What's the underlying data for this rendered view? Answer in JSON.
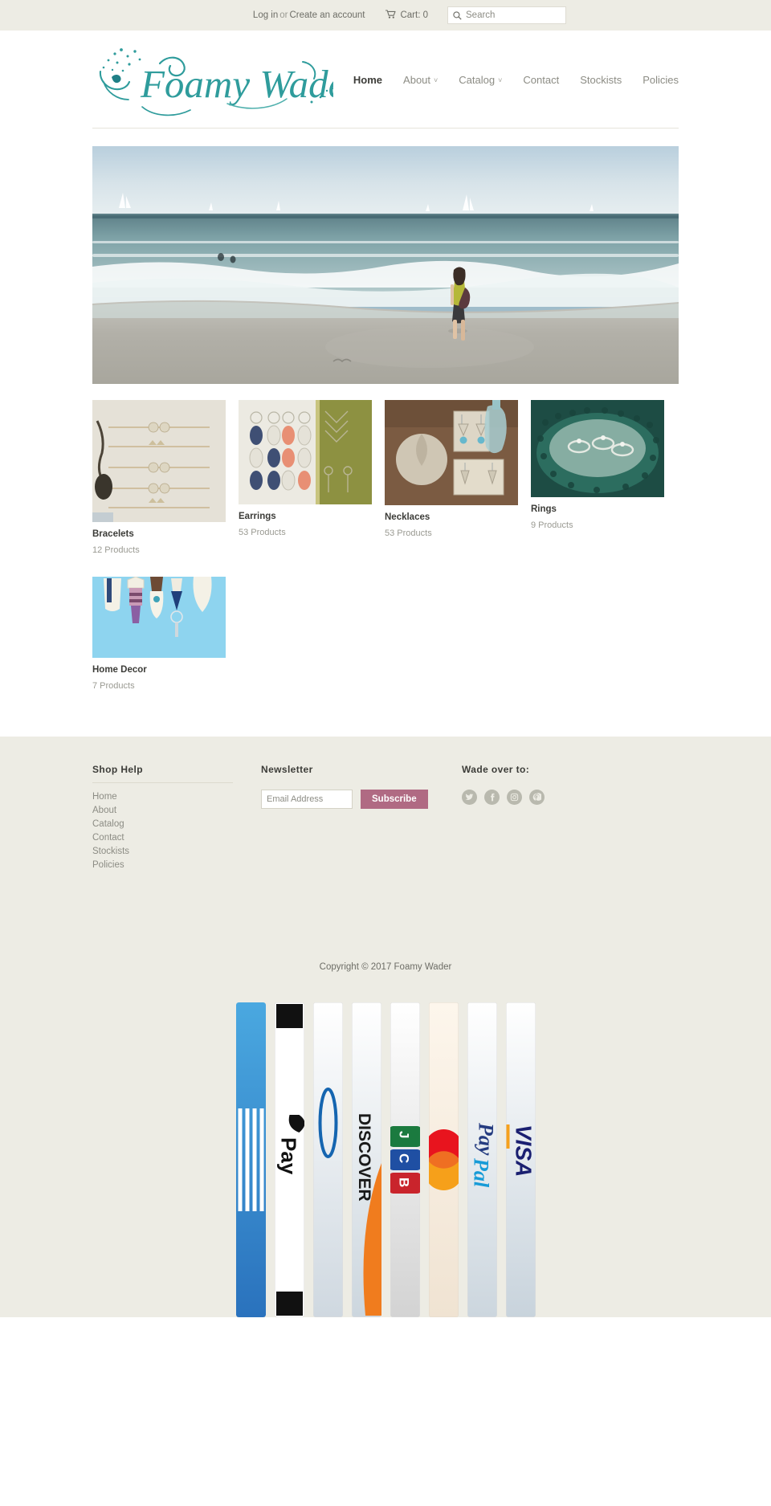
{
  "topbar": {
    "login_label": "Log in",
    "or_label": "or",
    "create_account_label": "Create an account",
    "cart_label": "Cart: 0",
    "cart_icon": "shopping-cart-icon",
    "search_icon": "search-icon",
    "search_placeholder": "Search",
    "search_value": ""
  },
  "header": {
    "logo_text": "Foamy Wader",
    "logo_color": "#2f9c9c",
    "nav": [
      {
        "label": "Home",
        "active": true,
        "caret": ""
      },
      {
        "label": "About",
        "active": false,
        "caret": "˅"
      },
      {
        "label": "Catalog",
        "active": false,
        "caret": "˅"
      },
      {
        "label": "Contact",
        "active": false,
        "caret": ""
      },
      {
        "label": "Stockists",
        "active": false,
        "caret": ""
      },
      {
        "label": "Policies",
        "active": false,
        "caret": ""
      }
    ]
  },
  "hero": {
    "alt": "Woman walking along the surf line on a sandy beach with sailboats on the horizon"
  },
  "collections": [
    {
      "title": "Bracelets",
      "count": "12 Products",
      "thumb_height": 152
    },
    {
      "title": "Earrings",
      "count": "53 Products",
      "thumb_height": 130
    },
    {
      "title": "Necklaces",
      "count": "53 Products",
      "thumb_height": 131
    },
    {
      "title": "Rings",
      "count": "9 Products",
      "thumb_height": 121
    },
    {
      "title": "Home Decor",
      "count": "7 Products",
      "thumb_height": 101
    }
  ],
  "footer": {
    "shop_help_heading": "Shop Help",
    "shop_help_links": [
      "Home",
      "About",
      "Catalog",
      "Contact",
      "Stockists",
      "Policies"
    ],
    "newsletter_heading": "Newsletter",
    "newsletter_placeholder": "Email Address",
    "newsletter_value": "",
    "subscribe_label": "Subscribe",
    "subscribe_color": "#b06a83",
    "social_heading": "Wade over to:",
    "socials": [
      "twitter-icon",
      "facebook-icon",
      "instagram-icon",
      "pinterest-icon"
    ],
    "copyright": "Copyright © 2017 Foamy Wader"
  },
  "payments": [
    {
      "name": "american-express"
    },
    {
      "name": "apple-pay"
    },
    {
      "name": "diners-club"
    },
    {
      "name": "discover"
    },
    {
      "name": "jcb"
    },
    {
      "name": "master"
    },
    {
      "name": "paypal"
    },
    {
      "name": "visa"
    }
  ]
}
